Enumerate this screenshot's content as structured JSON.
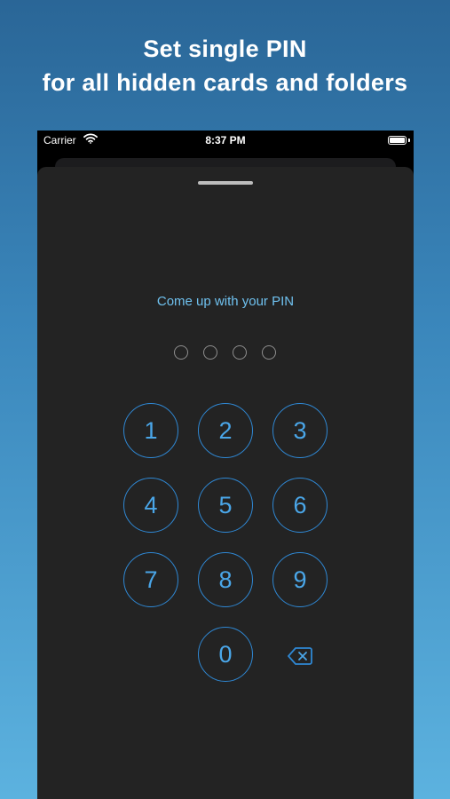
{
  "promo": {
    "line1": "Set single PIN",
    "line2": "for all hidden cards and folders"
  },
  "status_bar": {
    "carrier": "Carrier",
    "time": "8:37 PM",
    "wifi_icon": "wifi-icon",
    "battery_icon": "battery-icon"
  },
  "pin_screen": {
    "prompt": "Come up with your PIN",
    "pin_length": 4,
    "digits_entered": 0,
    "keys": [
      "1",
      "2",
      "3",
      "4",
      "5",
      "6",
      "7",
      "8",
      "9",
      "0"
    ],
    "backspace_icon": "backspace-icon"
  },
  "colors": {
    "accent": "#4aa6e8",
    "key_border": "#2f88d4",
    "prompt": "#6fc1ef",
    "sheet_background": "#232323",
    "page_gradient_top": "#2a6697",
    "page_gradient_bottom": "#5cb2df"
  }
}
